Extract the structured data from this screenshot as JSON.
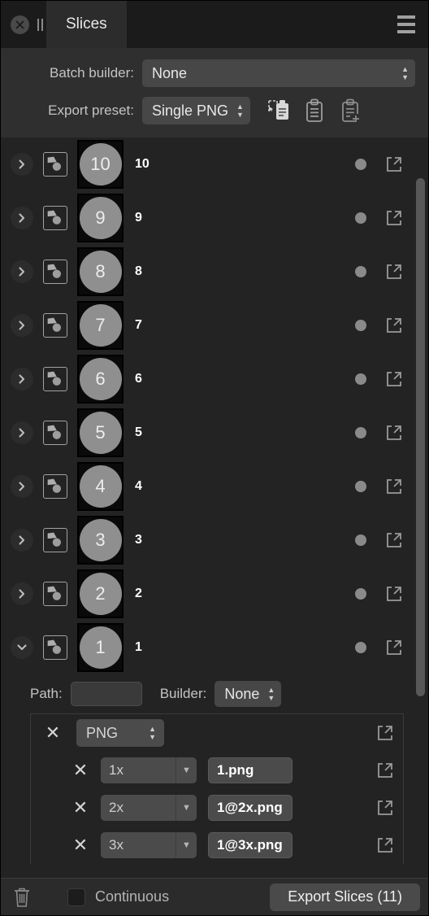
{
  "window": {
    "tab_label": "Slices",
    "close_icon": "close-circle-icon",
    "pause_icon": "pause-icon",
    "menu_icon": "hamburger-menu-icon"
  },
  "header": {
    "batch_builder_label": "Batch builder:",
    "batch_builder_value": "None",
    "export_preset_label": "Export preset:",
    "export_preset_value": "Single PNG",
    "preset_icons": [
      {
        "name": "apply-preset-icon"
      },
      {
        "name": "copy-preset-icon"
      },
      {
        "name": "add-preset-icon"
      }
    ]
  },
  "slices": [
    {
      "thumb": "10",
      "name": "10",
      "expanded": false
    },
    {
      "thumb": "9",
      "name": "9",
      "expanded": false
    },
    {
      "thumb": "8",
      "name": "8",
      "expanded": false
    },
    {
      "thumb": "7",
      "name": "7",
      "expanded": false
    },
    {
      "thumb": "6",
      "name": "6",
      "expanded": false
    },
    {
      "thumb": "5",
      "name": "5",
      "expanded": false
    },
    {
      "thumb": "4",
      "name": "4",
      "expanded": false
    },
    {
      "thumb": "3",
      "name": "3",
      "expanded": false
    },
    {
      "thumb": "2",
      "name": "2",
      "expanded": false
    },
    {
      "thumb": "1",
      "name": "1",
      "expanded": true
    }
  ],
  "detail": {
    "path_label": "Path:",
    "path_value": "",
    "builder_label": "Builder:",
    "builder_value": "None",
    "format_row": {
      "remove_label": "✕",
      "format_value": "PNG"
    },
    "scale_rows": [
      {
        "remove_label": "✕",
        "scale": "1x",
        "filename": "1.png"
      },
      {
        "remove_label": "✕",
        "scale": "2x",
        "filename": "1@2x.png"
      },
      {
        "remove_label": "✕",
        "scale": "3x",
        "filename": "1@3x.png"
      }
    ]
  },
  "bottom": {
    "trash_icon": "trash-icon",
    "continuous_label": "Continuous",
    "continuous_checked": false,
    "export_label": "Export Slices (11)"
  },
  "colors": {
    "panel_bg": "#232323",
    "header_bg": "#2f2f2f",
    "tabbar_bg": "#1b1b1b",
    "tab_active_bg": "#2c2c2c",
    "control_bg": "#474747",
    "accent_text": "#ffffff",
    "muted_text": "#c4c4c4",
    "thumb_circle": "#8f8f8f"
  }
}
